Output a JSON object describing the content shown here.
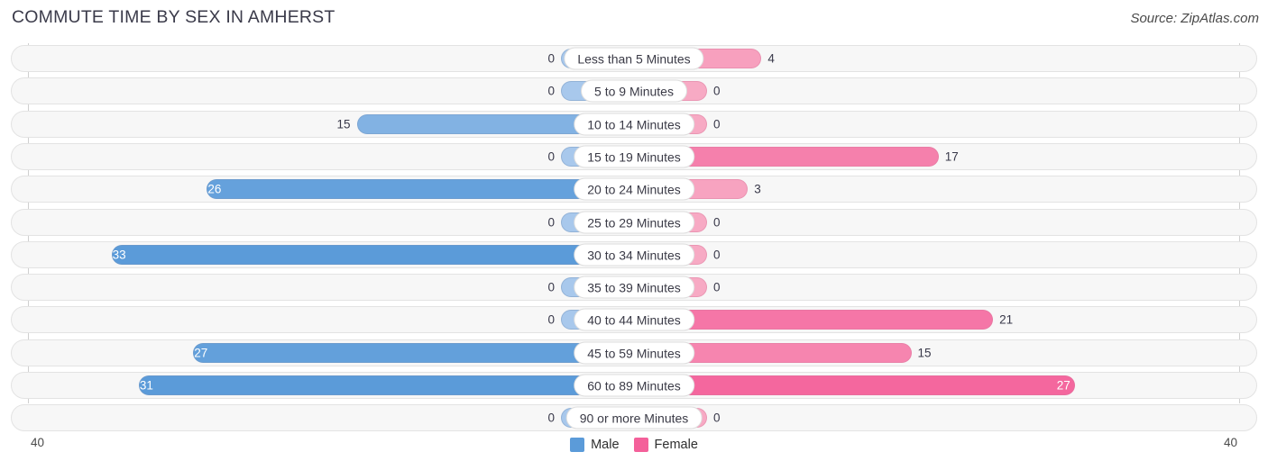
{
  "header": {
    "title": "COMMUTE TIME BY SEX IN AMHERST",
    "source": "Source: ZipAtlas.com"
  },
  "legend": {
    "items": [
      {
        "label": "Male",
        "color": "#5b9bd9"
      },
      {
        "label": "Female",
        "color": "#f4609a"
      }
    ]
  },
  "axis": {
    "left_tick": "40",
    "right_tick": "40"
  },
  "colors": {
    "male_strong": "#5b9bd9",
    "male_light": "#a8c8ec",
    "female_strong": "#f4609a",
    "female_light": "#f7aac4",
    "track_bg": "#f7f7f7",
    "track_border": "#e3e3e3"
  },
  "chart_data": {
    "type": "bar",
    "subtype": "diverging-population-pyramid",
    "title": "COMMUTE TIME BY SEX IN AMHERST",
    "xlabel": "",
    "ylabel": "",
    "xlim": [
      40,
      40
    ],
    "axis_max": 40,
    "grid": false,
    "legend_position": "bottom-center",
    "categories": [
      "Less than 5 Minutes",
      "5 to 9 Minutes",
      "10 to 14 Minutes",
      "15 to 19 Minutes",
      "20 to 24 Minutes",
      "25 to 29 Minutes",
      "30 to 34 Minutes",
      "35 to 39 Minutes",
      "40 to 44 Minutes",
      "45 to 59 Minutes",
      "60 to 89 Minutes",
      "90 or more Minutes"
    ],
    "series": [
      {
        "name": "Male",
        "direction": "left",
        "values": [
          0,
          0,
          15,
          0,
          26,
          0,
          33,
          0,
          0,
          27,
          31,
          0
        ]
      },
      {
        "name": "Female",
        "direction": "right",
        "values": [
          4,
          0,
          0,
          17,
          3,
          0,
          0,
          0,
          21,
          15,
          27,
          0
        ]
      }
    ]
  }
}
